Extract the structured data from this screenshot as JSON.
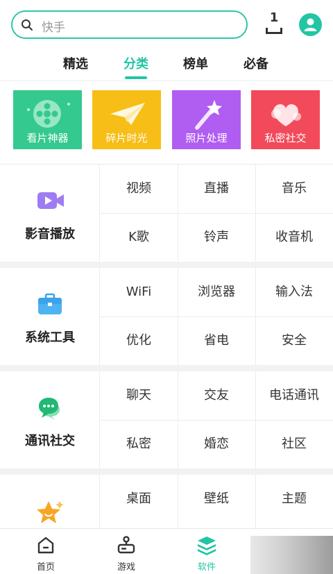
{
  "search": {
    "placeholder": "快手"
  },
  "downloads": {
    "count": "1"
  },
  "tabs": [
    {
      "label": "精选"
    },
    {
      "label": "分类"
    },
    {
      "label": "榜单"
    },
    {
      "label": "必备"
    }
  ],
  "active_tab": "分类",
  "banners": [
    {
      "label": "看片神器",
      "color": "#34c98e"
    },
    {
      "label": "碎片时光",
      "color": "#f7be17"
    },
    {
      "label": "照片处理",
      "color": "#b05df2"
    },
    {
      "label": "私密社交",
      "color": "#f24a5a"
    }
  ],
  "sections": [
    {
      "title": "影音播放",
      "items": [
        "视频",
        "直播",
        "音乐",
        "K歌",
        "铃声",
        "收音机"
      ]
    },
    {
      "title": "系统工具",
      "items": [
        "WiFi",
        "浏览器",
        "输入法",
        "优化",
        "省电",
        "安全"
      ]
    },
    {
      "title": "通讯社交",
      "items": [
        "聊天",
        "交友",
        "电话通讯",
        "私密",
        "婚恋",
        "社区"
      ]
    },
    {
      "title": "",
      "items": [
        "桌面",
        "壁纸",
        "主题"
      ]
    }
  ],
  "bottom_nav": [
    {
      "label": "首页",
      "icon": "home-icon"
    },
    {
      "label": "游戏",
      "icon": "gamepad-icon"
    },
    {
      "label": "软件",
      "icon": "software-stack-icon"
    }
  ],
  "colors": {
    "accent": "#22c5a4"
  }
}
